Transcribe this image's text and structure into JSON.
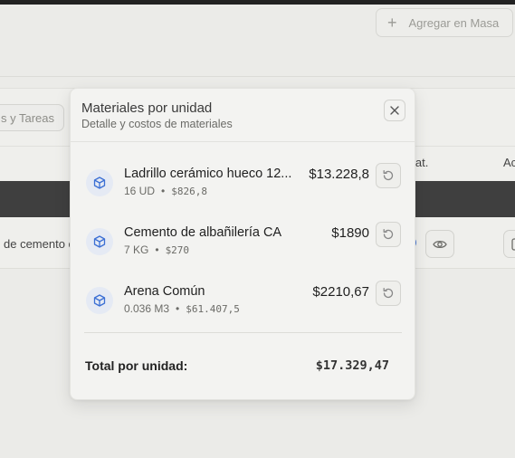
{
  "toolbar": {
    "bulk_add_label": "Agregar en Masa"
  },
  "background": {
    "tasks_pill": "s y Tareas",
    "columns": {
      "lat": "lat.",
      "actions": "Ac"
    },
    "row_text": "de cemento c"
  },
  "modal": {
    "title": "Materiales por unidad",
    "subtitle": "Detalle y costos de materiales",
    "items": [
      {
        "name": "Ladrillo cerámico hueco 12...",
        "qty": "16 UD",
        "unit_price": "$826,8",
        "total": "$13.228,8",
        "icon": "package-icon"
      },
      {
        "name": "Cemento de albañilería CA",
        "qty": "7 KG",
        "unit_price": "$270",
        "total": "$1890",
        "icon": "package-icon"
      },
      {
        "name": "Arena Común",
        "qty": "0.036 M3",
        "unit_price": "$61.407,5",
        "total": "$2210,67",
        "icon": "package-icon"
      }
    ],
    "total_label": "Total por unidad:",
    "total_value": "$17.329,47"
  },
  "colors": {
    "icon_blue": "#3b6fd4",
    "icon_bg": "#e5eaf4",
    "dark_band": "#3f3f3f"
  }
}
